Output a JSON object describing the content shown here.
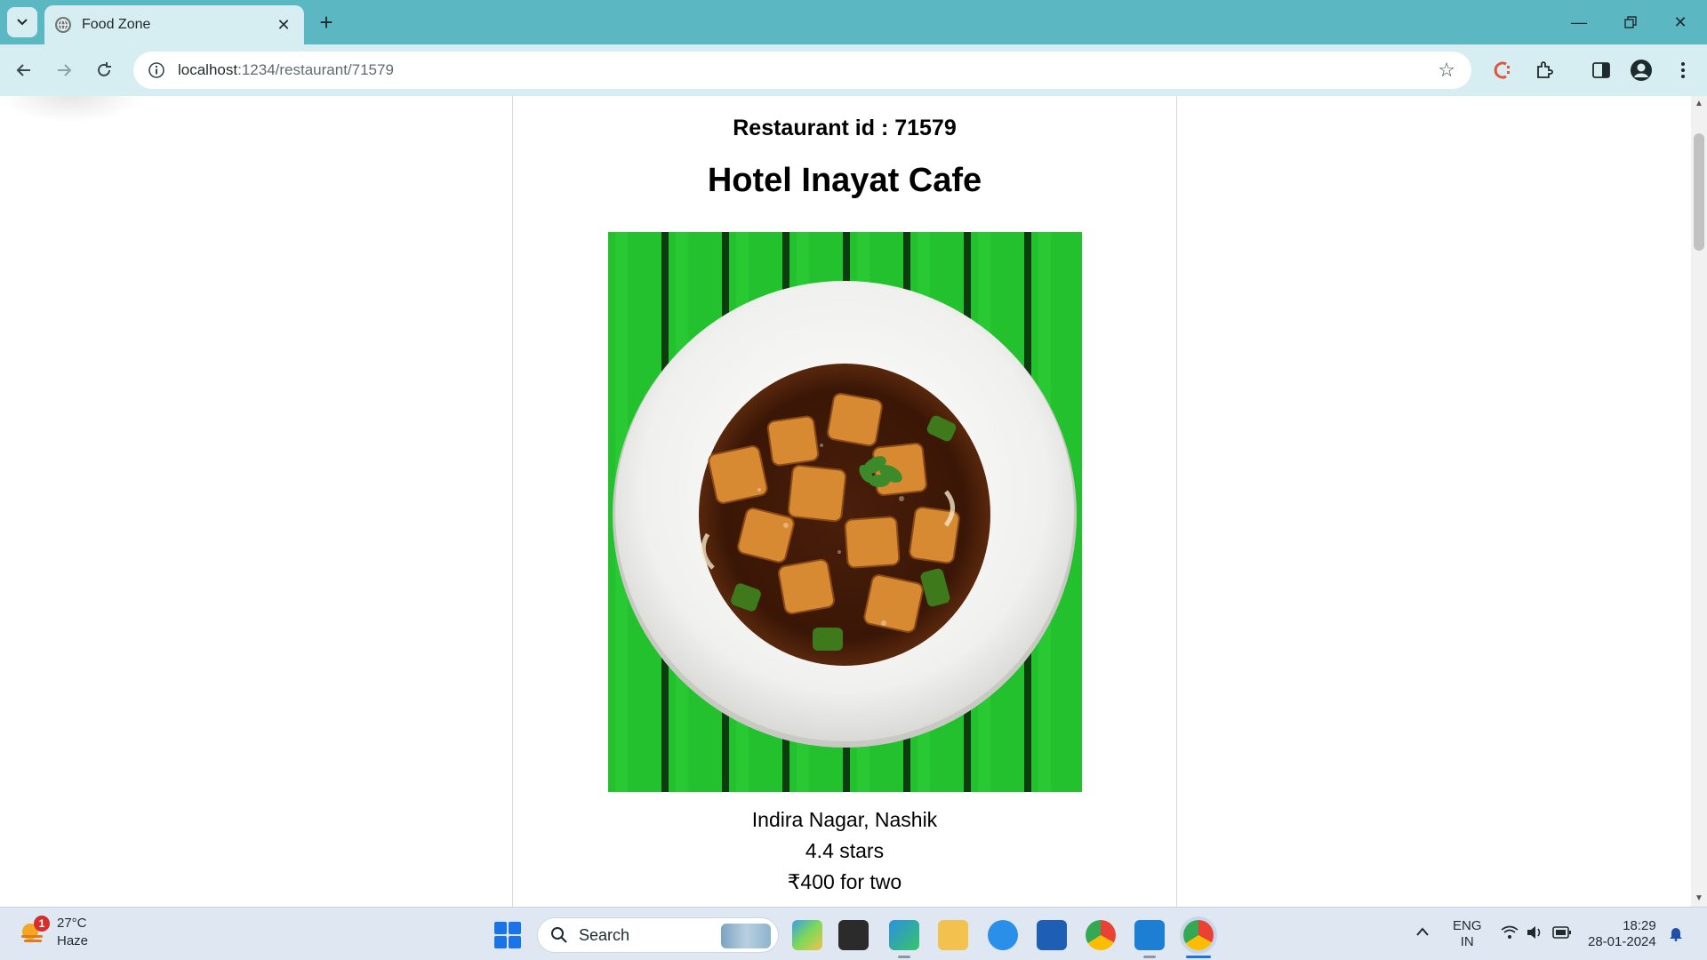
{
  "browser": {
    "tab_title": "Food Zone",
    "url_host": "localhost",
    "url_path": ":1234/restaurant/71579"
  },
  "page": {
    "restaurant_id_label": "Restaurant id : 71579",
    "restaurant_name": "Hotel Inayat Cafe",
    "location": "Indira Nagar, Nashik",
    "rating": "4.4 stars",
    "cost": "₹400 for two",
    "image_alt": "Paneer chilli in a white plate on green wooden table"
  },
  "taskbar": {
    "weather_temp": "27°C",
    "weather_desc": "Haze",
    "weather_badge": "1",
    "search_label": "Search",
    "lang_top": "ENG",
    "lang_bottom": "IN",
    "time": "18:29",
    "date": "28-01-2024"
  },
  "colors": {
    "tab_strip": "#5bb8c3",
    "toolbar": "#d6eef1",
    "food_background": "#1fbf2a"
  }
}
